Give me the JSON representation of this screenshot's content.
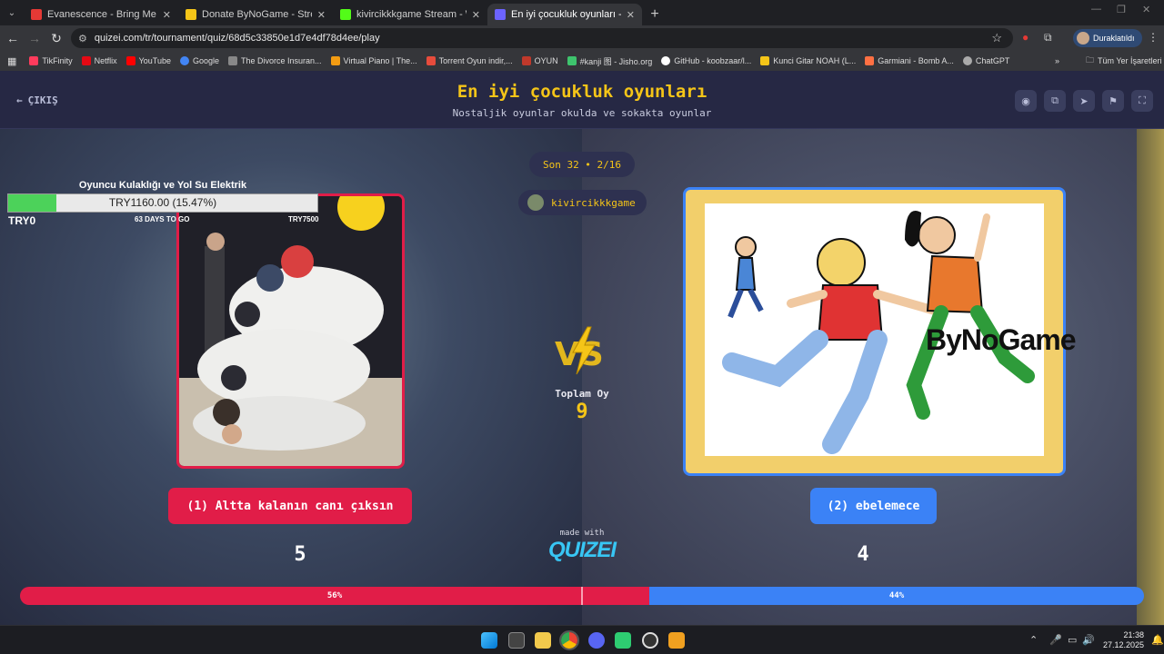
{
  "browser": {
    "tabs": [
      {
        "title": "Evanescence - Bring Me To Life",
        "favicon_color": "#e53935"
      },
      {
        "title": "Donate ByNoGame - Streamer",
        "favicon_color": "#f5c518"
      },
      {
        "title": "kivircikkkgame Stream - Watch",
        "favicon_color": "#53fc18"
      },
      {
        "title": "En iyi çocukluk oyunları - Tier Li",
        "favicon_color": "#6c63ff"
      }
    ],
    "url": "quizei.com/tr/tournament/quiz/68d5c33850e1d7e4df78d4ee/play",
    "profile_label": "Duraklatıldı",
    "bookmarks": [
      {
        "label": "TikFinity",
        "color": "#ff3b5c"
      },
      {
        "label": "Netflix",
        "color": "#e50914"
      },
      {
        "label": "YouTube",
        "color": "#ff0000"
      },
      {
        "label": "Google",
        "color": "#4285f4"
      },
      {
        "label": "The Divorce Insuran...",
        "color": "#888888"
      },
      {
        "label": "Virtual Piano | The...",
        "color": "#f39c12"
      },
      {
        "label": "Torrent Oyun indir,...",
        "color": "#e74c3c"
      },
      {
        "label": "OYUN",
        "color": "#c0392b"
      },
      {
        "label": "#kanji 图 - Jisho.org",
        "color": "#3ec46d"
      },
      {
        "label": "GitHub - koobzaar/l...",
        "color": "#ffffff"
      },
      {
        "label": "Kunci Gitar NOAH (L...",
        "color": "#f5c518"
      },
      {
        "label": "Garmiani - Bomb A...",
        "color": "#ff7043"
      },
      {
        "label": "ChatGPT",
        "color": "#aaaaaa"
      }
    ],
    "all_bookmarks_label": "Tüm Yer İşaretleri"
  },
  "page": {
    "exit_label": "ÇIKIŞ",
    "title": "En iyi çocukluk oyunları",
    "subtitle": "Nostaljik oyunlar okulda ve sokakta oyunlar",
    "round_label": "Son 32 • 2/16",
    "streamer_name": "kivircikkkgame",
    "total_votes_label": "Toplam Oy",
    "total_votes": "9",
    "made_with": "made with",
    "brand": "QUIZEI"
  },
  "donation_widget": {
    "title": "Oyuncu Kulaklığı ve Yol Su Elektrik",
    "amount_text": "TRY1160.00 (15.47%)",
    "progress": 0.1547,
    "min_label": "TRY0",
    "days_label": "63 DAYS TO GO",
    "max_label": "TRY7500"
  },
  "options": {
    "left": {
      "label": "(1) Altta kalanın canı çıksın",
      "votes": "5",
      "percent_label": "56%",
      "share": 0.56
    },
    "right": {
      "label": "(2) ebelemece",
      "votes": "4",
      "percent_label": "44%",
      "share": 0.44,
      "watermark": "ByNoGame"
    }
  },
  "taskbar": {
    "time": "21:38",
    "date": "27.12.2025"
  },
  "colors": {
    "accent_yellow": "#f5c518",
    "left_red": "#e11d48",
    "right_blue": "#3b82f6"
  }
}
